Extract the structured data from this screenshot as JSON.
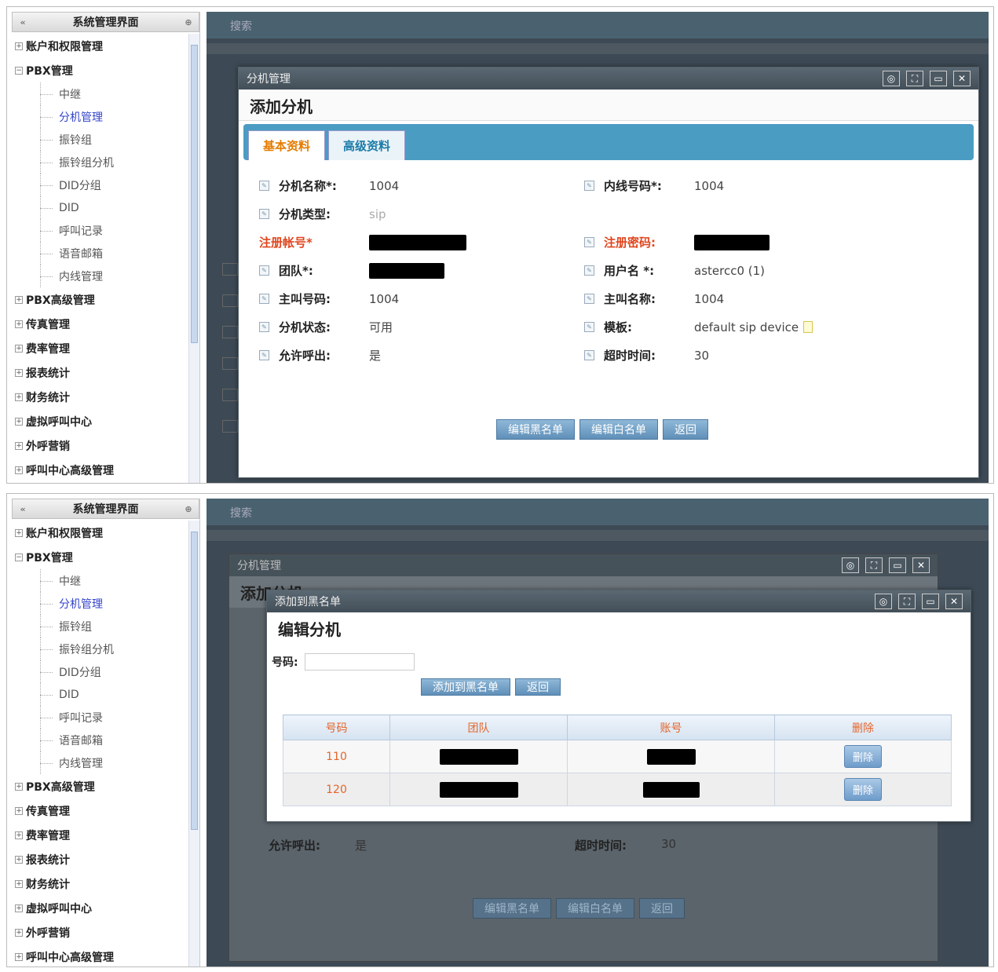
{
  "sidebar": {
    "title": "系统管理界面",
    "collapse_label": "«",
    "pin_label": "⊕",
    "sections_top": [
      {
        "label": "账户和权限管理",
        "toggle": "+"
      },
      {
        "label": "PBX管理",
        "toggle": "−"
      }
    ],
    "pbx_children": [
      "中继",
      "分机管理",
      "振铃组",
      "振铃组分机",
      "DID分组",
      "DID",
      "呼叫记录",
      "语音邮箱",
      "内线管理"
    ],
    "active_child": "分机管理",
    "sections_bottom": [
      {
        "label": "PBX高级管理",
        "toggle": "+"
      },
      {
        "label": "传真管理",
        "toggle": "+"
      },
      {
        "label": "费率管理",
        "toggle": "+"
      },
      {
        "label": "报表统计",
        "toggle": "+"
      },
      {
        "label": "财务统计",
        "toggle": "+"
      },
      {
        "label": "虚拟呼叫中心",
        "toggle": "+"
      },
      {
        "label": "外呼营销",
        "toggle": "+"
      },
      {
        "label": "呼叫中心高级管理",
        "toggle": "+"
      }
    ]
  },
  "main": {
    "search_label": "搜索"
  },
  "dialog1": {
    "window_title": "分机管理",
    "heading": "添加分机",
    "tabs": [
      "基本资料",
      "高级资料"
    ],
    "fields_left": [
      {
        "label": "分机名称*:",
        "value": "1004"
      },
      {
        "label": "分机类型:",
        "value": "sip"
      },
      {
        "label": "注册帐号*",
        "value": ""
      },
      {
        "label": "团队*:",
        "value": ""
      },
      {
        "label": "主叫号码:",
        "value": "1004"
      },
      {
        "label": "分机状态:",
        "value": "可用"
      },
      {
        "label": "允许呼出:",
        "value": "是"
      }
    ],
    "fields_right": [
      {
        "label": "内线号码*:",
        "value": "1004"
      },
      {
        "label": "注册密码:",
        "value": ""
      },
      {
        "label": "用户名 *:",
        "value": "astercc0 (1)"
      },
      {
        "label": "主叫名称:",
        "value": "1004"
      },
      {
        "label": "模板:",
        "value": "default sip device"
      },
      {
        "label": "超时时间:",
        "value": "30"
      }
    ],
    "buttons": [
      "编辑黑名单",
      "编辑白名单",
      "返回"
    ]
  },
  "dialog2": {
    "window_title": "添加到黑名单",
    "heading": "编辑分机",
    "number_label": "号码:",
    "number_value": "",
    "buttons": [
      "添加到黑名单",
      "返回"
    ],
    "table_headers": [
      "号码",
      "团队",
      "账号",
      "删除"
    ],
    "rows": [
      {
        "number": "110",
        "delete_label": "删除"
      },
      {
        "number": "120",
        "delete_label": "删除"
      }
    ],
    "bg_label_allow": "允许呼出:",
    "bg_value_allow": "是",
    "bg_label_timeout": "超时时间:",
    "bg_value_timeout": "30"
  },
  "colors": {
    "tab_bar": "#4b9cc3",
    "label_red": "#e0461f",
    "active_link": "#3344cc"
  }
}
